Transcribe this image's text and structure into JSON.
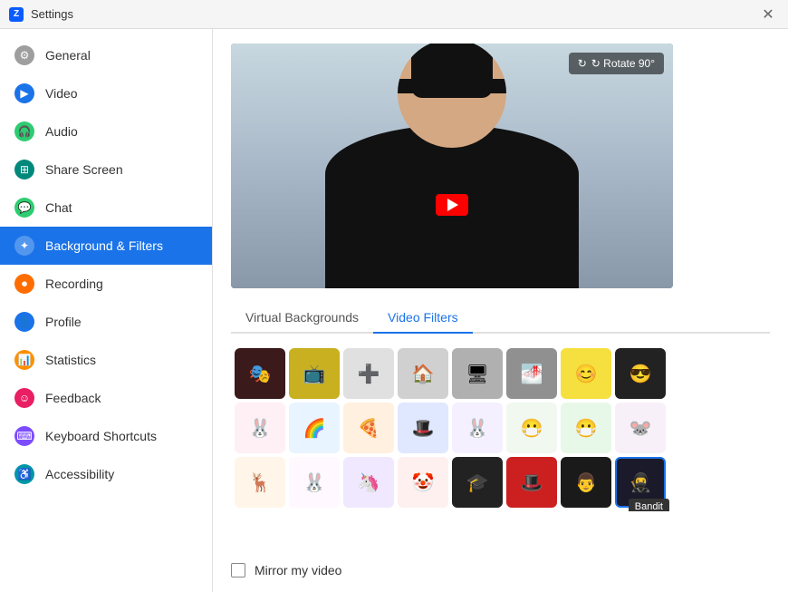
{
  "titleBar": {
    "title": "Settings",
    "closeLabel": "✕"
  },
  "sidebar": {
    "items": [
      {
        "id": "general",
        "label": "General",
        "iconColor": "gray",
        "iconSymbol": "⚙",
        "active": false
      },
      {
        "id": "video",
        "label": "Video",
        "iconColor": "green",
        "iconSymbol": "▶",
        "active": false
      },
      {
        "id": "audio",
        "label": "Audio",
        "iconColor": "green",
        "iconSymbol": "🎧",
        "active": false
      },
      {
        "id": "share-screen",
        "label": "Share Screen",
        "iconColor": "teal",
        "iconSymbol": "⊞",
        "active": false
      },
      {
        "id": "chat",
        "label": "Chat",
        "iconColor": "chat-green",
        "iconSymbol": "💬",
        "active": false
      },
      {
        "id": "background",
        "label": "Background & Filters",
        "iconColor": "blue",
        "iconSymbol": "🖼",
        "active": true
      },
      {
        "id": "recording",
        "label": "Recording",
        "iconColor": "orange",
        "iconSymbol": "⏺",
        "active": false
      },
      {
        "id": "profile",
        "label": "Profile",
        "iconColor": "blue",
        "iconSymbol": "👤",
        "active": false
      },
      {
        "id": "statistics",
        "label": "Statistics",
        "iconColor": "amber",
        "iconSymbol": "📊",
        "active": false
      },
      {
        "id": "feedback",
        "label": "Feedback",
        "iconColor": "pink",
        "iconSymbol": "😊",
        "active": false
      },
      {
        "id": "keyboard",
        "label": "Keyboard Shortcuts",
        "iconColor": "purple",
        "iconSymbol": "⌨",
        "active": false
      },
      {
        "id": "accessibility",
        "label": "Accessibility",
        "iconColor": "cyan",
        "iconSymbol": "♿",
        "active": false
      }
    ]
  },
  "mainPanel": {
    "rotateBtn": "↻ Rotate 90°",
    "tabs": [
      {
        "id": "virtual-bg",
        "label": "Virtual Backgrounds",
        "active": false
      },
      {
        "id": "video-filters",
        "label": "Video Filters",
        "active": true
      }
    ],
    "filters": [
      {
        "id": "f1",
        "emoji": "🎭",
        "bg": "#3a1a1a",
        "selected": false
      },
      {
        "id": "f2",
        "emoji": "📺",
        "bg": "#c8b020",
        "selected": false
      },
      {
        "id": "f3",
        "emoji": "➕",
        "bg": "#e0e0e0",
        "selected": false
      },
      {
        "id": "f4",
        "emoji": "🏠",
        "bg": "#d0d0d0",
        "selected": false
      },
      {
        "id": "f5",
        "emoji": "🖥",
        "bg": "#b0b0b0",
        "selected": false
      },
      {
        "id": "f6",
        "emoji": "🌁",
        "bg": "#909090",
        "selected": false
      },
      {
        "id": "f7",
        "emoji": "😊",
        "bg": "#f5e040",
        "selected": false
      },
      {
        "id": "f8",
        "emoji": "😎",
        "bg": "#222",
        "selected": false
      },
      {
        "id": "f9",
        "emoji": "🐰",
        "bg": "#fff0f5",
        "selected": false
      },
      {
        "id": "f10",
        "emoji": "🌈",
        "bg": "#e8f4ff",
        "selected": false
      },
      {
        "id": "f11",
        "emoji": "🍕",
        "bg": "#fff0e0",
        "selected": false
      },
      {
        "id": "f12",
        "emoji": "🎩",
        "bg": "#e0e8ff",
        "selected": false
      },
      {
        "id": "f13",
        "emoji": "🐰",
        "bg": "#f5f0ff",
        "selected": false
      },
      {
        "id": "f14",
        "emoji": "😷",
        "bg": "#f0f8f0",
        "selected": false
      },
      {
        "id": "f15",
        "emoji": "😷",
        "bg": "#e8f8e8",
        "selected": false
      },
      {
        "id": "f16",
        "emoji": "🐭",
        "bg": "#f8f0f8",
        "selected": false
      },
      {
        "id": "f17",
        "emoji": "🦌",
        "bg": "#fff5e8",
        "selected": false
      },
      {
        "id": "f18",
        "emoji": "🐰",
        "bg": "#fff8ff",
        "selected": false
      },
      {
        "id": "f19",
        "emoji": "🦄",
        "bg": "#f0e8ff",
        "selected": false
      },
      {
        "id": "f20",
        "emoji": "🤡",
        "bg": "#fff0f0",
        "selected": false
      },
      {
        "id": "f21",
        "emoji": "🎓",
        "bg": "#222",
        "selected": false
      },
      {
        "id": "f22",
        "emoji": "🎩",
        "bg": "#cc2020",
        "selected": false
      },
      {
        "id": "f23",
        "emoji": "👨",
        "bg": "#1a1a1a",
        "selected": false
      },
      {
        "id": "f24",
        "emoji": "🥷",
        "bg": "#1a1a2a",
        "selected": true,
        "tooltip": "Bandit"
      }
    ],
    "mirrorCheckbox": false,
    "mirrorLabel": "Mirror my video"
  }
}
